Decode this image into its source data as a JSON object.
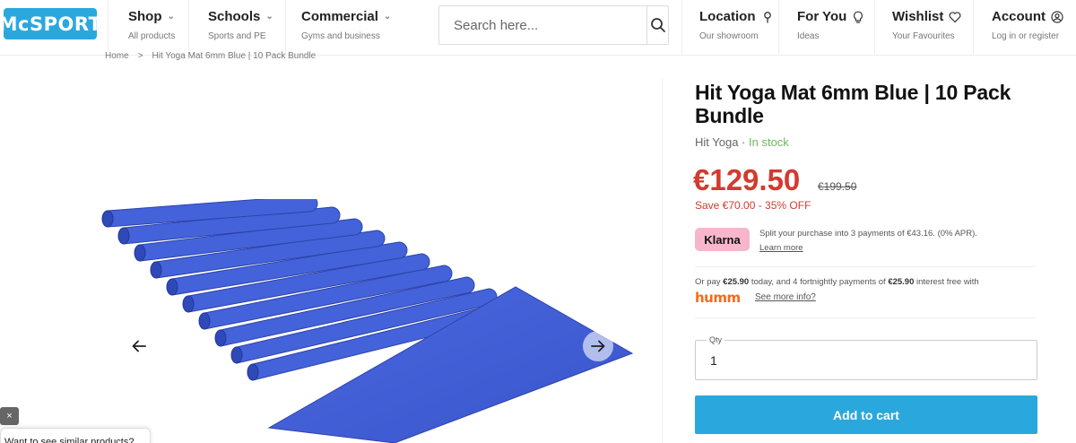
{
  "header": {
    "logo_text": "McSPORT",
    "nav": [
      {
        "title": "Shop",
        "sub": "All products"
      },
      {
        "title": "Schools",
        "sub": "Sports and PE"
      },
      {
        "title": "Commercial",
        "sub": "Gyms and business"
      }
    ],
    "search_placeholder": "Search here...",
    "account_nav": [
      {
        "title": "Location",
        "sub": "Our showroom",
        "icon": "pin-icon"
      },
      {
        "title": "For You",
        "sub": "Ideas",
        "icon": "lightbulb-icon"
      },
      {
        "title": "Wishlist",
        "sub": "Your Favourites",
        "icon": "heart-icon"
      },
      {
        "title": "Account",
        "sub": "Log in or register",
        "icon": "user-icon"
      }
    ]
  },
  "breadcrumb": {
    "home": "Home",
    "separator": ">",
    "current": "Hit Yoga Mat 6mm Blue | 10 Pack Bundle"
  },
  "product": {
    "title": "Hit Yoga Mat 6mm Blue | 10 Pack Bundle",
    "brand": "Hit Yoga",
    "stock_separator": " · ",
    "stock": "In stock",
    "price": "€129.50",
    "old_price": "€199.50",
    "save": "Save €70.00 - 35% OFF",
    "klarna": {
      "logo": "Klarna",
      "text": "Split your purchase into 3 payments of €43.16. (0% APR).",
      "link": "Learn more"
    },
    "humm": {
      "text_prefix": "Or pay ",
      "amount1": "€25.90",
      "text_mid": " today, and 4 fortnightly payments of ",
      "amount2": "€25.90",
      "text_suffix": " interest free with",
      "logo": "humm",
      "link": "See more info?"
    },
    "qty_label": "Qty",
    "qty_value": "1",
    "add_to_cart": "Add to cart"
  },
  "popup": {
    "close": "×",
    "text": "Want to see similar products?"
  },
  "colors": {
    "brand_blue": "#2aa8dd",
    "price_red": "#d23b2e",
    "stock_green": "#6cb85a",
    "klarna_pink": "#f7b6cc",
    "humm_orange": "#f26b1d",
    "mat_blue": "#3d5cd6"
  }
}
